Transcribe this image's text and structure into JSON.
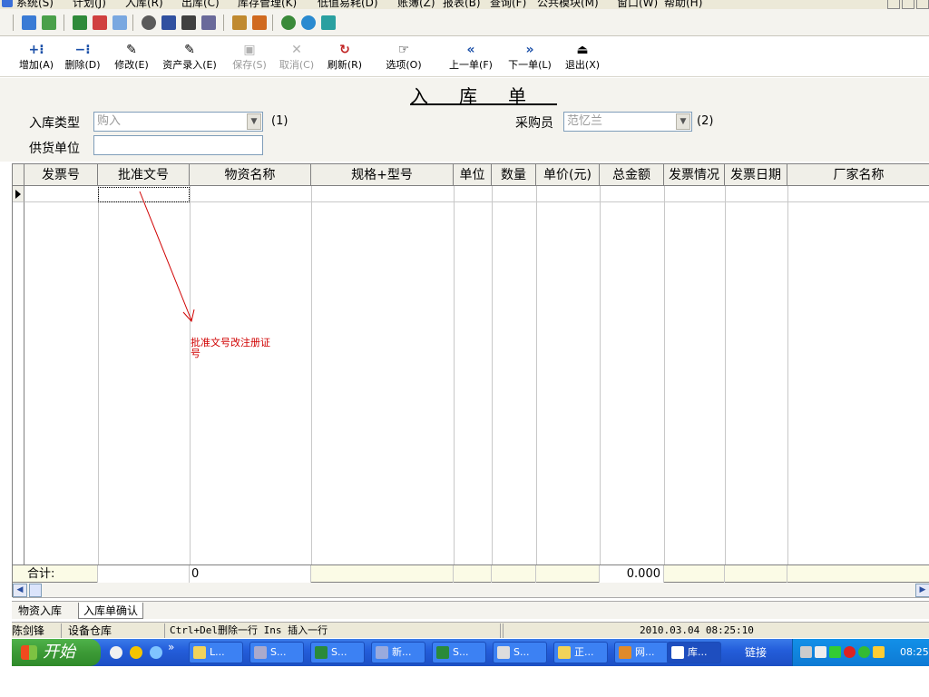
{
  "menubar": {
    "items": [
      "系统(S)",
      "计划(J)",
      "入库(R)",
      "出库(C)",
      "库存管理(K)",
      "低值易耗(D)",
      "账簿(Z)",
      "报表(B)",
      "查询(F)",
      "公共模块(M)",
      "窗口(W)",
      "帮助(H)"
    ]
  },
  "toolbar": {
    "add": {
      "label": "增加(A)",
      "icon": "add-row-icon",
      "glyph": "+⁝"
    },
    "delete": {
      "label": "删除(D)",
      "icon": "delete-row-icon",
      "glyph": "−⁝"
    },
    "modify": {
      "label": "修改(E)",
      "icon": "edit-doc-icon",
      "glyph": "✎"
    },
    "asset_entry": {
      "label": "资产录入(E)",
      "icon": "asset-doc-icon",
      "glyph": "✎"
    },
    "save": {
      "label": "保存(S)",
      "icon": "save-icon",
      "glyph": "▣"
    },
    "cancel": {
      "label": "取消(C)",
      "icon": "cancel-icon",
      "glyph": "✕"
    },
    "refresh": {
      "label": "刷新(R)",
      "icon": "refresh-icon",
      "glyph": "↻"
    },
    "options": {
      "label": "选项(O)",
      "icon": "options-icon",
      "glyph": "☞"
    },
    "prev": {
      "label": "上一单(F)",
      "icon": "prev-icon",
      "glyph": "«"
    },
    "next": {
      "label": "下一单(L)",
      "icon": "next-icon",
      "glyph": "»"
    },
    "exit": {
      "label": "退出(X)",
      "icon": "exit-icon",
      "glyph": "⏏"
    }
  },
  "form": {
    "title": "入库单",
    "entry_type_label": "入库类型",
    "entry_type_value": "购入",
    "entry_type_hint": "(1)",
    "buyer_label": "采购员",
    "buyer_value": "范忆兰",
    "buyer_hint": "(2)",
    "supplier_label": "供货单位",
    "supplier_value": ""
  },
  "grid": {
    "columns": [
      "发票号",
      "批准文号",
      "物资名称",
      "规格+型号",
      "单位",
      "数量",
      "单价(元)",
      "总金额",
      "发票情况",
      "发票日期",
      "厂家名称"
    ],
    "total_label": "合计:",
    "total_name_value": "0",
    "total_amount": "0.000"
  },
  "annotation": {
    "text": "批准文号改注册证号",
    "color": "#d00000"
  },
  "bottom_tabs": [
    "物资入库",
    "入库单确认"
  ],
  "statusbar": {
    "user": "陈剑锋",
    "warehouse": "设备仓库",
    "hint": "Ctrl+Del删除一行   Ins 插入一行",
    "datetime": "2010.03.04 08:25:10"
  },
  "taskbar": {
    "start_label": "开始",
    "quicklaunch": [
      "»"
    ],
    "tasks": [
      "L...",
      "S...",
      "S...",
      "新...",
      "S...",
      "S...",
      "正...",
      "网...",
      "库..."
    ],
    "links_label": "链接",
    "clock": "08:25"
  },
  "colors": {
    "accent": "#245edb",
    "annotation": "#d00000",
    "total_row_bg": "#fbfbe6"
  }
}
